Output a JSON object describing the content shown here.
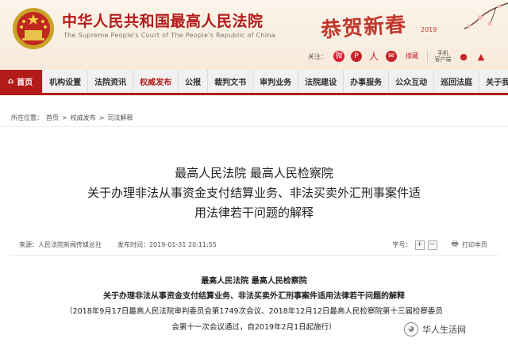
{
  "header": {
    "title": "中华人民共和国最高人民法院",
    "subtitle": "The Supreme People's Court of The People's Republic of China",
    "greeting": "恭贺新春",
    "greeting_year": "2019",
    "follow_label": "关注：",
    "baidu_label": "搜藏",
    "mobile_label_1": "手机",
    "mobile_label_2": "客户端"
  },
  "nav": {
    "items": [
      {
        "label": "首页"
      },
      {
        "label": "机构设置"
      },
      {
        "label": "法院资讯"
      },
      {
        "label": "权威发布"
      },
      {
        "label": "公报"
      },
      {
        "label": "裁判文书"
      },
      {
        "label": "审判业务"
      },
      {
        "label": "法院建设"
      },
      {
        "label": "办事服务"
      },
      {
        "label": "公众互动"
      },
      {
        "label": "巡回法庭"
      },
      {
        "label": "关于我们"
      }
    ]
  },
  "breadcrumb": {
    "prefix": "所在位置：",
    "items": [
      "首页",
      "权威发布",
      "司法解释"
    ],
    "separator": ">"
  },
  "article": {
    "title_line_1": "最高人民法院 最高人民检察院",
    "title_line_2": "关于办理非法从事资金支付结算业务、非法买卖外汇刑事案件适",
    "title_line_3": "用法律若干问题的解释",
    "source": "来源：人民法院新闻传媒总社",
    "published": "发布时间：2019-01-31 20:11:55",
    "font_size_label": "字号：",
    "zoom_in": "+",
    "zoom_out": "−",
    "print_label": "打印本页",
    "body_line_1": "最高人民法院 最高人民检察院",
    "body_line_2": "关于办理非法从事资金支付结算业务、非法买卖外汇刑事案件适用法律若干问题的解释",
    "body_line_3": "（2018年9月17日最高人民法院审判委员会第1749次会议、2018年12月12日最高人民检察院第十三届检察委员",
    "body_line_4": "会第十一次会议通过，自2019年2月1日起施行）"
  },
  "watermark": {
    "text": "华人生活网"
  },
  "colors": {
    "brand_red": "#b31b1b",
    "nav_bg": "#f1f1f1",
    "header_bg": "#fbf4ea"
  }
}
